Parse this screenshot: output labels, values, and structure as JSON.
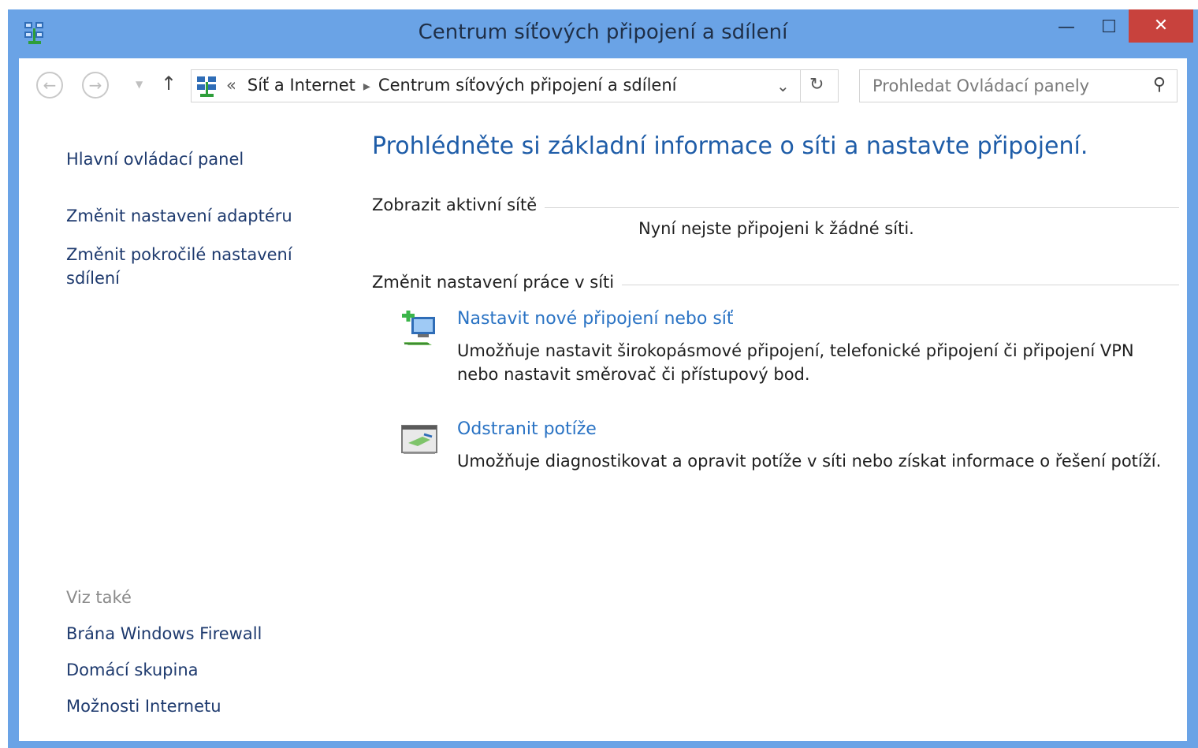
{
  "window": {
    "title": "Centrum síťových připojení a sdílení",
    "minimize": "—",
    "maximize": "☐",
    "close": "✕"
  },
  "nav": {
    "back": "←",
    "forward": "→",
    "up": "↑",
    "breadcrumb_prefix": "«",
    "breadcrumb_1": "Síť a Internet",
    "breadcrumb_sep": "▸",
    "breadcrumb_2": "Centrum síťových připojení a sdílení",
    "refresh": "↻",
    "search_placeholder": "Prohledat Ovládací panely",
    "search_icon": "⚲"
  },
  "sidebar": {
    "home": "Hlavní ovládací panel",
    "adapter": "Změnit nastavení adaptéru",
    "advanced": "Změnit pokročilé nastavení sdílení",
    "see_also": "Viz také",
    "links": [
      "Brána Windows Firewall",
      "Domácí skupina",
      "Možnosti Internetu"
    ]
  },
  "main": {
    "heading": "Prohlédněte si základní informace o síti a nastavte připojení.",
    "active_section": "Zobrazit aktivní sítě",
    "no_connection": "Nyní nejste připojeni k žádné síti.",
    "change_section": "Změnit nastavení práce v síti",
    "tasks": [
      {
        "title": "Nastavit nové připojení nebo síť",
        "desc": "Umožňuje nastavit širokopásmové připojení, telefonické připojení či připojení VPN nebo nastavit směrovač či přístupový bod.",
        "icon": "new-connection-icon"
      },
      {
        "title": "Odstranit potíže",
        "desc": "Umožňuje diagnostikovat a opravit potíže v síti nebo získat informace o řešení potíží.",
        "icon": "troubleshoot-icon"
      }
    ]
  },
  "colors": {
    "frame": "#6aa3e6",
    "close": "#c8423d",
    "link": "#1e3a6e",
    "heading": "#1f5da8",
    "task_link": "#2a73c4"
  }
}
